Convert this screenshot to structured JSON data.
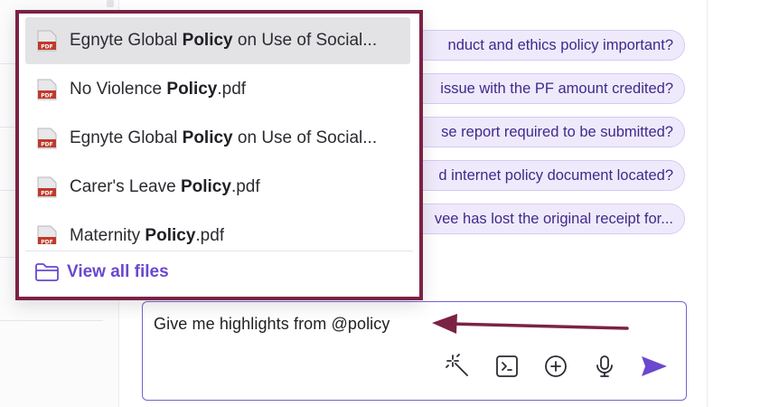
{
  "composer": {
    "text": "Give me highlights from @policy"
  },
  "suggestions": [
    "nduct and ethics policy important?",
    "issue with the PF amount credited?",
    "se report required to be submitted?",
    "d internet policy document located?",
    "vee has lost the original receipt for..."
  ],
  "file_menu": {
    "items": [
      {
        "before": "Egnyte Global ",
        "match": "Policy",
        "after": " on Use of Social...",
        "icon": "pdf-file-icon",
        "active": true
      },
      {
        "before": "No Violence ",
        "match": "Policy",
        "after": ".pdf",
        "icon": "pdf-file-icon",
        "active": false
      },
      {
        "before": "Egnyte Global ",
        "match": "Policy",
        "after": " on Use of Social...",
        "icon": "pdf-file-icon",
        "active": false
      },
      {
        "before": "Carer's Leave ",
        "match": "Policy",
        "after": ".pdf",
        "icon": "pdf-file-icon",
        "active": false
      },
      {
        "before": "Maternity ",
        "match": "Policy",
        "after": ".pdf",
        "icon": "pdf-file-icon",
        "active": false
      }
    ],
    "view_all_label": "View all files"
  },
  "toolbar": {
    "icons": [
      "magic-wand-icon",
      "terminal-icon",
      "plus-circle-icon",
      "microphone-icon",
      "send-icon"
    ]
  },
  "colors": {
    "accent": "#6a48cf",
    "popup_border": "#7b2245",
    "annotation_arrow": "#7b2245",
    "chip_bg": "#efeafb",
    "chip_text": "#3f2a8c"
  }
}
